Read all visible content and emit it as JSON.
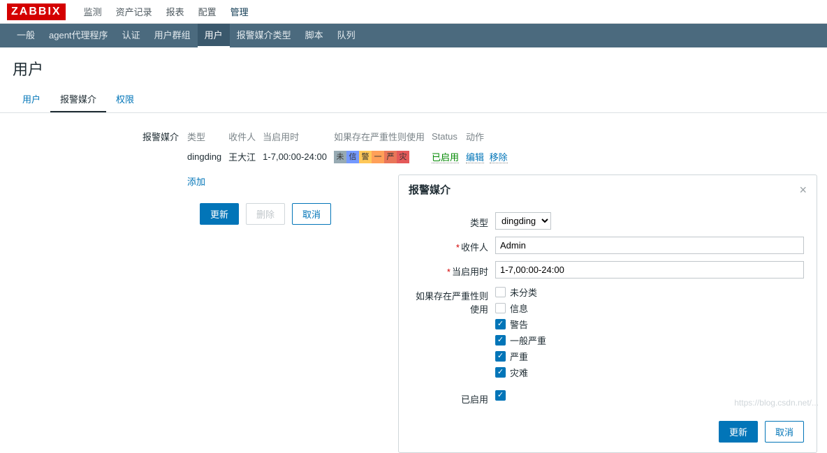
{
  "logo": "ZABBIX",
  "topnav": [
    "监测",
    "资产记录",
    "报表",
    "配置",
    "管理"
  ],
  "topnav_active": 4,
  "subnav": [
    "一般",
    "agent代理程序",
    "认证",
    "用户群组",
    "用户",
    "报警媒介类型",
    "脚本",
    "队列"
  ],
  "subnav_active": 4,
  "page_title": "用户",
  "tabs": [
    "用户",
    "报警媒介",
    "权限"
  ],
  "tabs_active": 1,
  "media": {
    "label": "报警媒介",
    "columns": [
      "类型",
      "收件人",
      "当启用时",
      "如果存在严重性则使用",
      "Status",
      "动作"
    ],
    "rows": [
      {
        "type": "dingding",
        "sendto": "王大江",
        "when": "1-7,00:00-24:00",
        "sev": [
          "未",
          "信",
          "警",
          "一",
          "严",
          "灾"
        ],
        "status": "已启用",
        "actions": [
          "编辑",
          "移除"
        ]
      }
    ],
    "add_label": "添加"
  },
  "buttons": {
    "update": "更新",
    "delete": "删除",
    "cancel": "取消"
  },
  "modal": {
    "title": "报警媒介",
    "labels": {
      "type": "类型",
      "sendto": "收件人",
      "when": "当启用时",
      "severity": "如果存在严重性则使用",
      "enabled": "已启用"
    },
    "type_value": "dingding",
    "sendto_value": "Admin",
    "when_value": "1-7,00:00-24:00",
    "severities": [
      {
        "label": "未分类",
        "checked": false
      },
      {
        "label": "信息",
        "checked": false
      },
      {
        "label": "警告",
        "checked": true
      },
      {
        "label": "一般严重",
        "checked": true
      },
      {
        "label": "严重",
        "checked": true
      },
      {
        "label": "灾难",
        "checked": true
      }
    ],
    "enabled_checked": true,
    "buttons": {
      "update": "更新",
      "cancel": "取消"
    }
  },
  "watermark": "https://blog.csdn.net/..."
}
